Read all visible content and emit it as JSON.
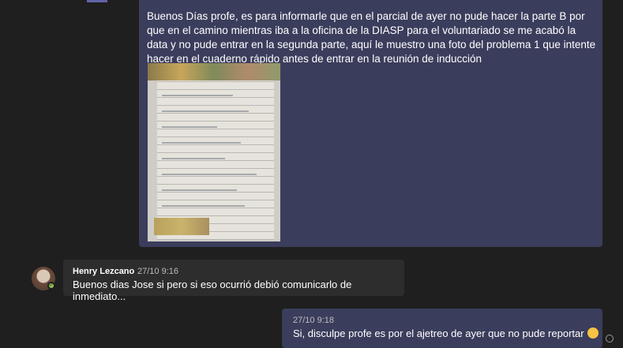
{
  "messages": {
    "self_1": {
      "text": "Buenos Días profe, es para informarle que en el parcial de ayer no pude hacer la parte B por que en el camino mientras iba a la oficina de la DIASP para el voluntariado se me acabó la data y no pude entrar en la segunda parte, aquí le muestro una foto del problema 1 que intente hacer en el cuaderno rápido antes de entrar en la reunión de inducción",
      "image_icon": "notebook-photo"
    },
    "reply": {
      "sender": "Henry Lezcano",
      "time": "27/10 9:16",
      "text": "Buenos dias Jose si pero si eso ocurrió debió comunicarlo de inmediato..."
    },
    "self_2": {
      "time": "27/10 9:18",
      "text": "Si, disculpe profe es por el ajetreo de ayer que no pude reportar",
      "emoji_icon": "sad-face-emoji"
    }
  },
  "colors": {
    "self_bubble": "#3b3d5c",
    "other_bubble": "#2d2d2d",
    "background": "#1f1f1f",
    "presence": "#92c353",
    "accent": "#6264a7"
  }
}
